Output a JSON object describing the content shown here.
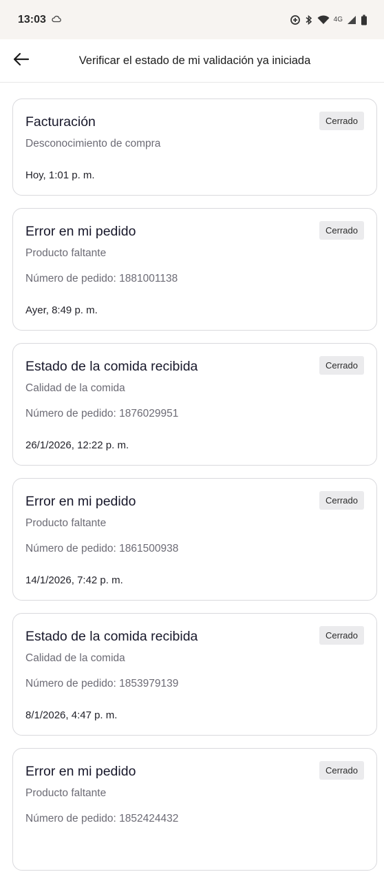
{
  "status_bar": {
    "time": "13:03",
    "network": "4G"
  },
  "header": {
    "title": "Verificar el estado de mi validación ya iniciada"
  },
  "cards": [
    {
      "title": "Facturación",
      "subtitle": "Desconocimiento de compra",
      "order": "",
      "date": "Hoy, 1:01 p. m.",
      "status": "Cerrado"
    },
    {
      "title": "Error en mi pedido",
      "subtitle": "Producto faltante",
      "order": "Número de pedido: 1881001138",
      "date": "Ayer, 8:49 p. m.",
      "status": "Cerrado"
    },
    {
      "title": "Estado de la comida recibida",
      "subtitle": "Calidad de la comida",
      "order": "Número de pedido: 1876029951",
      "date": "26/1/2026, 12:22 p. m.",
      "status": "Cerrado"
    },
    {
      "title": "Error en mi pedido",
      "subtitle": "Producto faltante",
      "order": "Número de pedido: 1861500938",
      "date": "14/1/2026, 7:42 p. m.",
      "status": "Cerrado"
    },
    {
      "title": "Estado de la comida recibida",
      "subtitle": "Calidad de la comida",
      "order": "Número de pedido: 1853979139",
      "date": "8/1/2026, 4:47 p. m.",
      "status": "Cerrado"
    },
    {
      "title": "Error en mi pedido",
      "subtitle": "Producto faltante",
      "order": "Número de pedido: 1852424432",
      "date": "",
      "status": "Cerrado"
    }
  ],
  "icons": {
    "back": "arrow-left-icon",
    "weather": "cloud-icon",
    "status": [
      "data-saver-icon",
      "bluetooth-icon",
      "wifi-icon",
      "cellular-signal-icon",
      "battery-icon"
    ]
  },
  "colors": {
    "status_bar_bg": "#f7f4f1",
    "card_border": "#d9d9dd",
    "badge_bg": "#ebebed",
    "secondary_text": "#6c6b75"
  }
}
